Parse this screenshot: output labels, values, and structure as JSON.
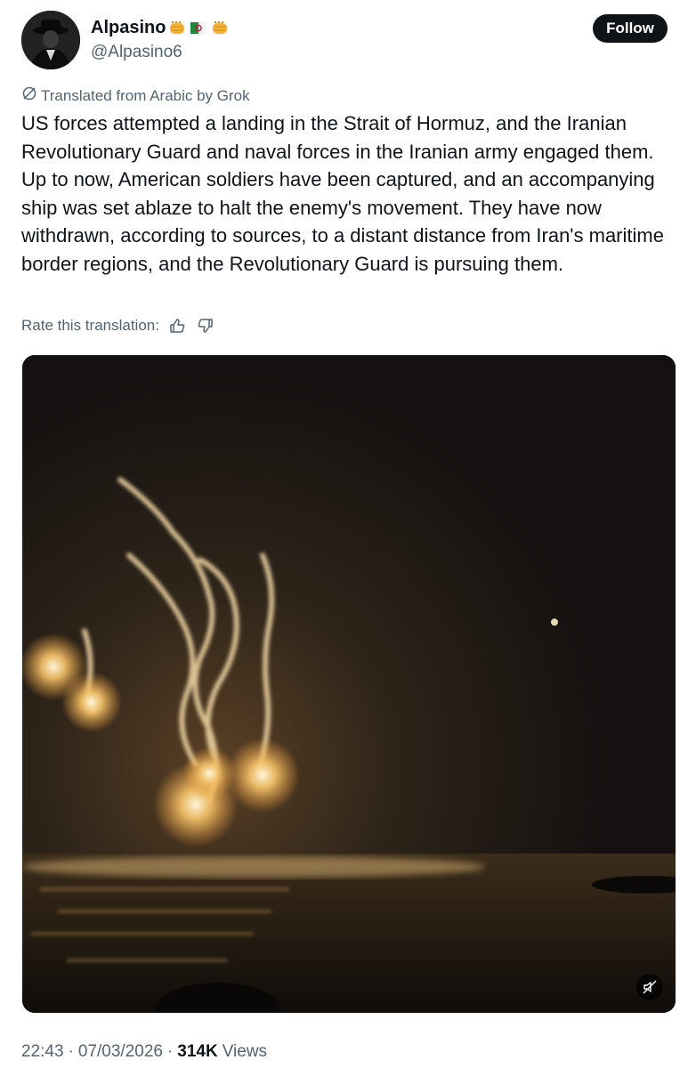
{
  "author": {
    "display_name": "Alpasino",
    "handle": "@Alpasino6",
    "badges": [
      "oncoming-fist-emoji",
      "algeria-flag",
      "oncoming-fist-emoji"
    ]
  },
  "follow_label": "Follow",
  "translation": {
    "notice": "Translated from Arabic by Grok",
    "rate_label": "Rate this translation:",
    "icons": [
      "thumbs-up-icon",
      "thumbs-down-icon"
    ]
  },
  "tweet": {
    "text": "US forces attempted a landing in the Strait of Hormuz, and the Iranian Revolutionary Guard and naval forces in the Iranian army engaged them. Up to now, American soldiers have been captured, and an accompanying ship was set ablaze to halt the enemy's movement. They have now withdrawn, according to sources, to a distant distance from Iran's maritime border regions, and the Revolutionary Guard is pursuing them."
  },
  "media": {
    "type": "video",
    "controls": [
      "muted-speaker-icon"
    ]
  },
  "meta": {
    "time": "22:43",
    "separator": "·",
    "date": "07/03/2026",
    "views_count": "314K",
    "views_label": "Views"
  },
  "colors": {
    "text_primary": "#0f1419",
    "text_secondary": "#536471",
    "button_bg": "#0f1419",
    "background": "#ffffff"
  }
}
